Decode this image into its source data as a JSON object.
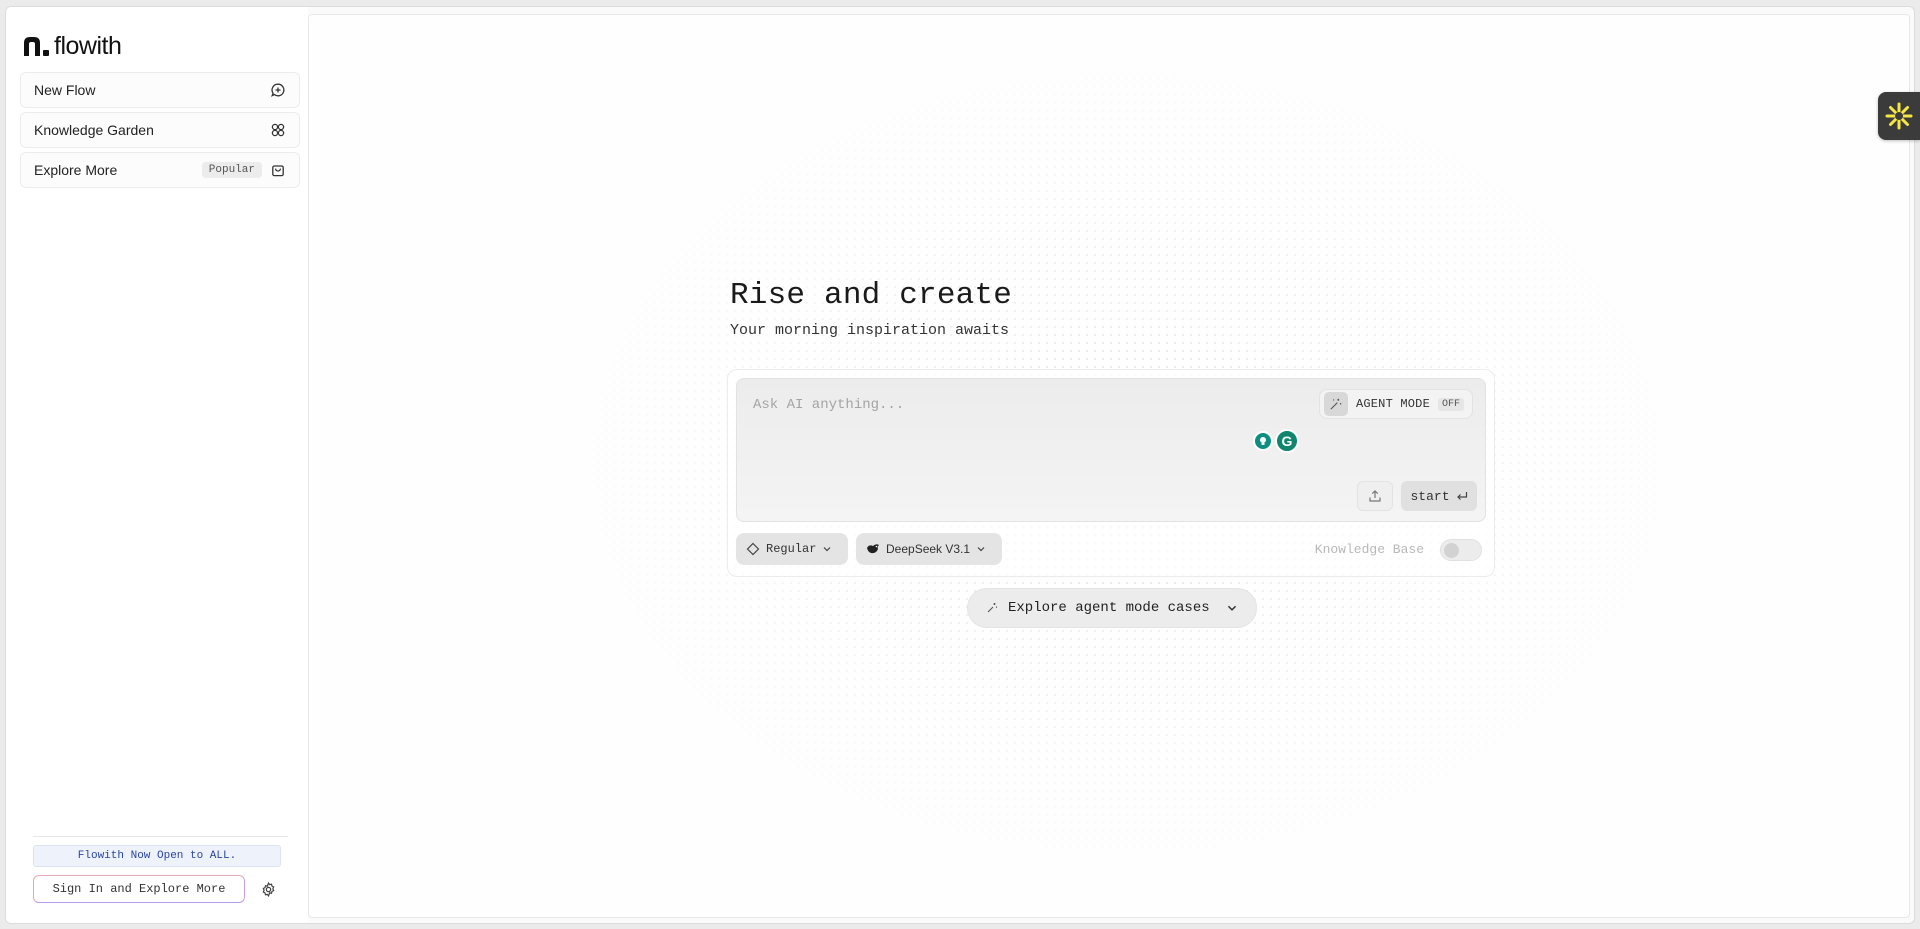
{
  "app": {
    "logo_text": "flowith"
  },
  "sidebar": {
    "items": [
      {
        "label": "New Flow",
        "icon": "new-chat-icon"
      },
      {
        "label": "Knowledge Garden",
        "icon": "garden-icon"
      },
      {
        "label": "Explore More",
        "badge": "Popular",
        "icon": "bag-icon"
      }
    ],
    "announcement": "Flowith Now Open to ALL.",
    "signin_label": "Sign In and Explore More"
  },
  "hero": {
    "title": "Rise and create",
    "subtitle": "Your morning inspiration awaits"
  },
  "composer": {
    "placeholder": "Ask AI anything...",
    "agent_mode_label": "AGENT MODE",
    "agent_mode_state": "OFF",
    "start_label": "start",
    "mode_label": "Regular",
    "model_label": "DeepSeek V3.1",
    "knowledge_base_label": "Knowledge Base",
    "knowledge_base_enabled": false
  },
  "explore_cases_label": "Explore agent mode cases",
  "colors": {
    "accent_yellow": "#f5e642",
    "widget_dark": "#3b3b3b",
    "extension_green": "#12856f"
  }
}
